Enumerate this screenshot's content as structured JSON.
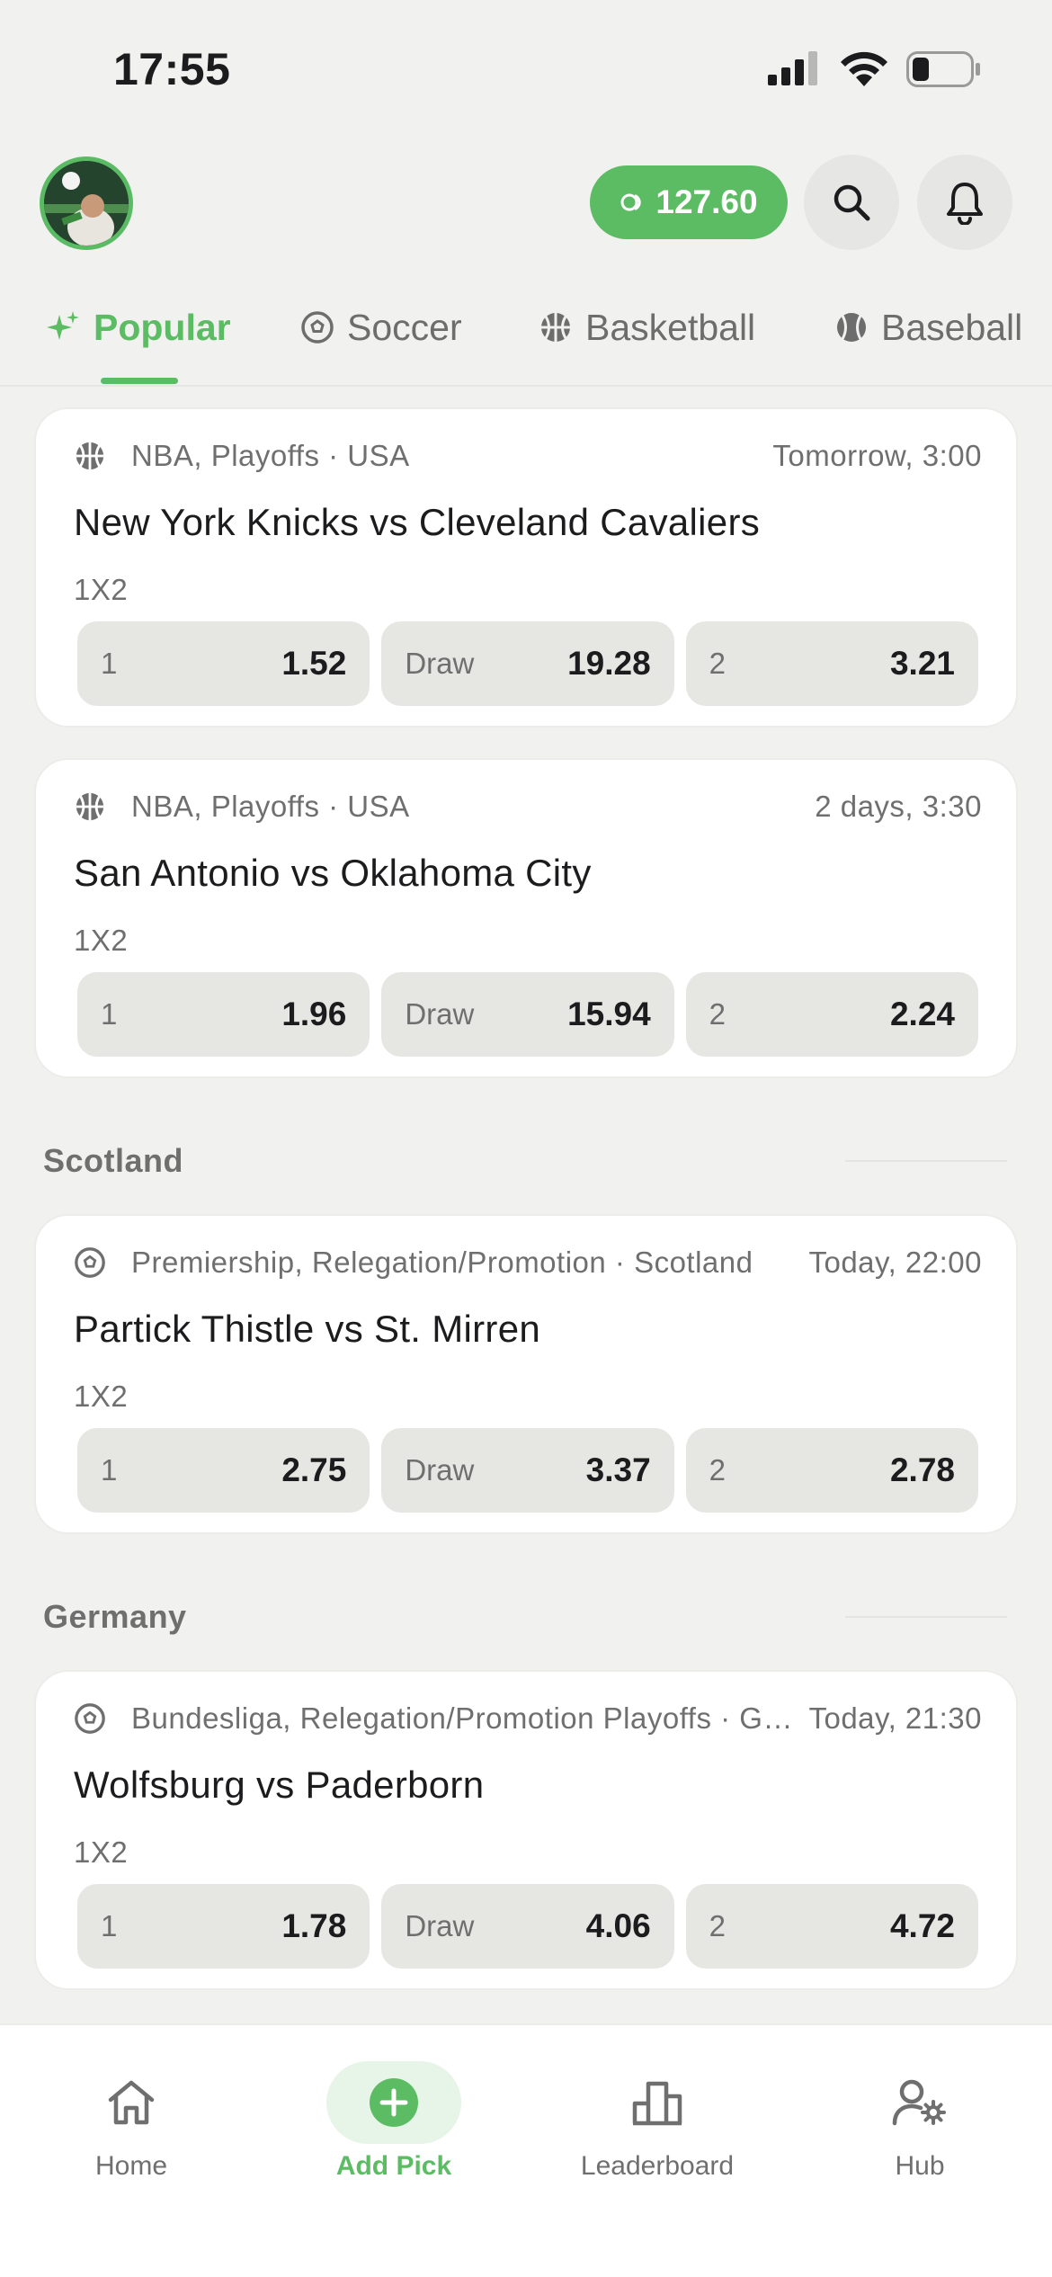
{
  "status_bar": {
    "time": "17:55"
  },
  "header": {
    "balance": "127.60"
  },
  "tabs": [
    {
      "label": "Popular",
      "icon": "sparkle-icon"
    },
    {
      "label": "Soccer",
      "icon": "soccer-ball-icon"
    },
    {
      "label": "Basketball",
      "icon": "basketball-icon"
    },
    {
      "label": "Baseball",
      "icon": "baseball-icon"
    }
  ],
  "cards": [
    {
      "league": "NBA, Playoffs · USA",
      "time": "Tomorrow, 3:00",
      "title": "New York Knicks vs Cleveland Cavaliers",
      "market": "1X2",
      "odds": [
        {
          "label": "1",
          "value": "1.52"
        },
        {
          "label": "Draw",
          "value": "19.28"
        },
        {
          "label": "2",
          "value": "3.21"
        }
      ]
    },
    {
      "league": "NBA, Playoffs · USA",
      "time": "2 days, 3:30",
      "title": "San Antonio vs Oklahoma City",
      "market": "1X2",
      "odds": [
        {
          "label": "1",
          "value": "1.96"
        },
        {
          "label": "Draw",
          "value": "15.94"
        },
        {
          "label": "2",
          "value": "2.24"
        }
      ]
    },
    {
      "league": "Premiership, Relegation/Promotion · Scotland",
      "time": "Today, 22:00",
      "title": "Partick Thistle vs St. Mirren",
      "market": "1X2",
      "odds": [
        {
          "label": "1",
          "value": "2.75"
        },
        {
          "label": "Draw",
          "value": "3.37"
        },
        {
          "label": "2",
          "value": "2.78"
        }
      ]
    },
    {
      "league": "Bundesliga, Relegation/Promotion Playoffs · Germany",
      "time": "Today, 21:30",
      "title": "Wolfsburg vs Paderborn",
      "market": "1X2",
      "odds": [
        {
          "label": "1",
          "value": "1.78"
        },
        {
          "label": "Draw",
          "value": "4.06"
        },
        {
          "label": "2",
          "value": "4.72"
        }
      ]
    }
  ],
  "sections": [
    {
      "title": "Scotland"
    },
    {
      "title": "Germany"
    }
  ],
  "bottom_nav": [
    {
      "label": "Home",
      "icon": "home-icon"
    },
    {
      "label": "Add Pick",
      "icon": "add-circle-icon"
    },
    {
      "label": "Leaderboard",
      "icon": "leaderboard-icon"
    },
    {
      "label": "Hub",
      "icon": "user-settings-icon"
    }
  ],
  "colors": {
    "accent": "#5cbc63",
    "background": "#f1f1ef",
    "card": "#ffffff",
    "odds_bg": "#e6e6e3"
  }
}
